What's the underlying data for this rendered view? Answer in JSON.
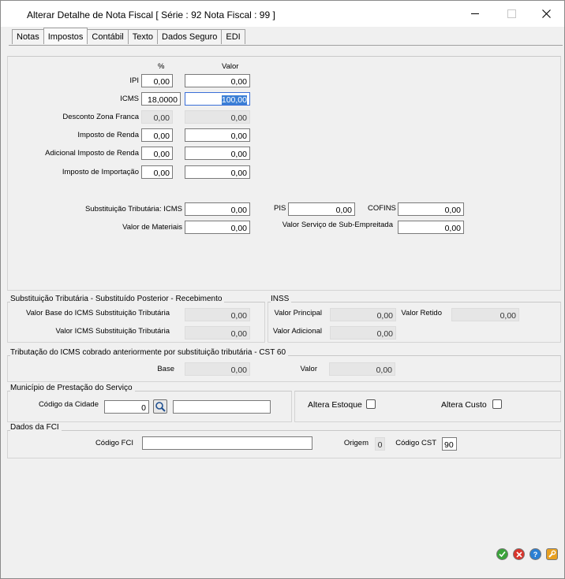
{
  "window": {
    "title": "Alterar Detalhe de Nota Fiscal [ Série : 92 Nota Fiscal : 99 ]",
    "minimize_icon": "minimize-icon",
    "maximize_icon": "maximize-icon",
    "close_icon": "close-icon"
  },
  "tabs": [
    {
      "label": "Notas"
    },
    {
      "label": "Impostos",
      "active": true
    },
    {
      "label": "Contábil"
    },
    {
      "label": "Texto"
    },
    {
      "label": "Dados Seguro"
    },
    {
      "label": "EDI"
    }
  ],
  "impostos": {
    "col_percent": "%",
    "col_valor": "Valor",
    "rows": {
      "ipi": {
        "label": "IPI",
        "percent": "0,00",
        "valor": "0,00"
      },
      "icms": {
        "label": "ICMS",
        "percent": "18,0000",
        "valor": "100,00"
      },
      "desconto_zona_franca": {
        "label": "Desconto Zona Franca",
        "percent": "0,00",
        "valor": "0,00"
      },
      "imposto_renda": {
        "label": "Imposto de Renda",
        "percent": "0,00",
        "valor": "0,00"
      },
      "adicional_imposto_renda": {
        "label": "Adicional Imposto de Renda",
        "percent": "0,00",
        "valor": "0,00"
      },
      "imposto_importacao": {
        "label": "Imposto de Importação",
        "percent": "0,00",
        "valor": "0,00"
      }
    },
    "subst_trib_icms": {
      "label": "Substituição Tributária: ICMS",
      "value": "0,00"
    },
    "valor_materiais": {
      "label": "Valor de Materiais",
      "value": "0,00"
    },
    "pis": {
      "label": "PIS",
      "value": "0,00"
    },
    "cofins": {
      "label": "COFINS",
      "value": "0,00"
    },
    "valor_servico_sub": {
      "label": "Valor Serviço de Sub-Empreitada",
      "value": "0,00"
    }
  },
  "subst_posterior": {
    "title": "Substituição Tributária - Substituído Posterior - Recebimento",
    "valor_base": {
      "label": "Valor Base do ICMS Substituição Tributária",
      "value": "0,00"
    },
    "valor_icms": {
      "label": "Valor ICMS Substituição Tributária",
      "value": "0,00"
    }
  },
  "inss": {
    "title": "INSS",
    "valor_principal": {
      "label": "Valor Principal",
      "value": "0,00"
    },
    "valor_retido": {
      "label": "Valor Retido",
      "value": "0,00"
    },
    "valor_adicional": {
      "label": "Valor Adicional",
      "value": "0,00"
    }
  },
  "cst60": {
    "title": "Tributação do ICMS cobrado anteriormente por substituição tributária - CST 60",
    "base": {
      "label": "Base",
      "value": "0,00"
    },
    "valor": {
      "label": "Valor",
      "value": "0,00"
    }
  },
  "municipio": {
    "title": "Município de Prestação do Serviço",
    "codigo_cidade_label": "Código da Cidade",
    "codigo_cidade_value": "0",
    "cidade_nome": "",
    "search_icon": "search-icon"
  },
  "altera": {
    "estoque_label": "Altera Estoque",
    "custo_label": "Altera Custo"
  },
  "fci": {
    "title": "Dados da FCI",
    "codigo_fci_label": "Código FCI",
    "codigo_fci_value": "",
    "origem_label": "Origem",
    "origem_value": "0",
    "codigo_cst_label": "Código CST",
    "codigo_cst_value": "90"
  },
  "actions": {
    "ok_icon": "ok-icon",
    "cancel_icon": "cancel-icon",
    "help_icon": "help-icon",
    "tools_icon": "wrench-icon",
    "colors": {
      "ok": "#3aa33a",
      "cancel": "#d9342b",
      "help": "#2a7fd4",
      "tools": "#e8a020"
    }
  }
}
